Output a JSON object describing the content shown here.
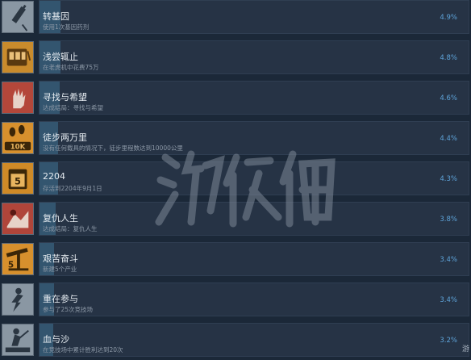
{
  "colors": {
    "background": "#1b2838",
    "bar": "#263345",
    "fill": "#33556f",
    "percent": "#5ea4da"
  },
  "achievements": [
    {
      "title": "转基因",
      "desc": "使用1次基因药剂",
      "percent": "4.9%",
      "percent_value": 4.9,
      "icon": "syringe-icon",
      "icon_bg": "#8a97a3"
    },
    {
      "title": "浅尝辄止",
      "desc": "在老虎机中花费75万",
      "percent": "4.8%",
      "percent_value": 4.8,
      "icon": "slot-machine-icon",
      "icon_bg": "#c98b2c"
    },
    {
      "title": "寻找与希望",
      "desc": "达成结局：寻找与希望",
      "percent": "4.6%",
      "percent_value": 4.6,
      "icon": "hand-icon",
      "icon_bg": "#b4473a"
    },
    {
      "title": "徒步两万里",
      "desc": "没有任何载具的情况下，徒步里程数达到10000公里",
      "percent": "4.4%",
      "percent_value": 4.4,
      "icon": "footprints-10k-icon",
      "icon_bg": "#d7902d"
    },
    {
      "title": "2204",
      "desc": "存活到2204年9月1日",
      "percent": "4.3%",
      "percent_value": 4.3,
      "icon": "calendar-icon",
      "icon_bg": "#cf8a27"
    },
    {
      "title": "复仇人生",
      "desc": "达成结局：复仇人生",
      "percent": "3.8%",
      "percent_value": 3.8,
      "icon": "revenge-icon",
      "icon_bg": "#b0453a"
    },
    {
      "title": "艰苦奋斗",
      "desc": "新建5个产业",
      "percent": "3.4%",
      "percent_value": 3.4,
      "icon": "oil-pump-icon",
      "icon_bg": "#d7902d"
    },
    {
      "title": "重在参与",
      "desc": "参与了25次竞技场",
      "percent": "3.4%",
      "percent_value": 3.4,
      "icon": "fighter-icon",
      "icon_bg": "#8a97a3"
    },
    {
      "title": "血与沙",
      "desc": "在竞技场中累计胜利达到20次",
      "percent": "3.2%",
      "percent_value": 3.2,
      "icon": "arena-icon",
      "icon_bg": "#8a97a3"
    }
  ],
  "watermark": "游侠网",
  "corner_text": "游"
}
